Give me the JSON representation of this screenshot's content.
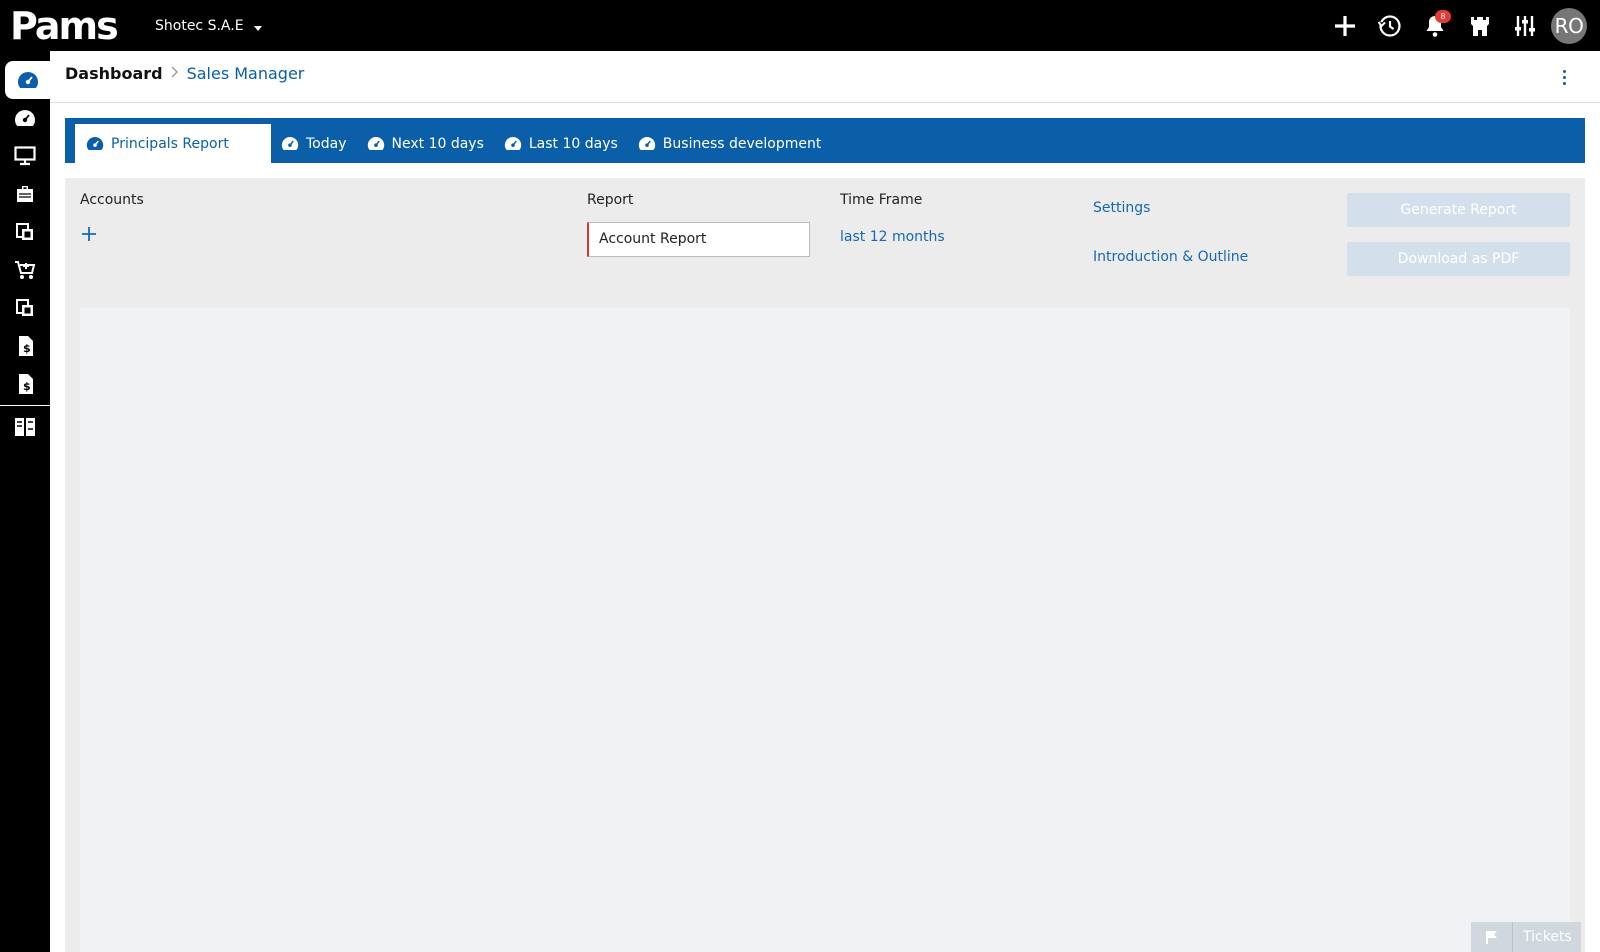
{
  "app": {
    "logo_text": "Pams",
    "company": "Shotec S.A.E",
    "notification_count": "8",
    "avatar_initials": "RO"
  },
  "top_icons": [
    "plus-icon",
    "history-icon",
    "bell-icon",
    "castle-icon",
    "sliders-icon"
  ],
  "sidebar": {
    "items": [
      "dashboard-icon",
      "gauge-icon",
      "monitor-icon",
      "briefcase-icon",
      "documents-icon",
      "cart-icon",
      "documents-icon",
      "invoice-icon",
      "invoice-icon",
      "reports-icon"
    ]
  },
  "breadcrumb": {
    "root": "Dashboard",
    "current": "Sales Manager"
  },
  "tabs": [
    {
      "label": "Principals Report",
      "active": true
    },
    {
      "label": "Today",
      "active": false
    },
    {
      "label": "Next 10 days",
      "active": false
    },
    {
      "label": "Last 10 days",
      "active": false
    },
    {
      "label": "Business development",
      "active": false
    }
  ],
  "form": {
    "accounts_label": "Accounts",
    "report_label": "Report",
    "report_value": "Account Report",
    "timeframe_label": "Time Frame",
    "timeframe_value": "last 12 months",
    "settings_link": "Settings",
    "intro_link": "Introduction & Outline",
    "generate_button": "Generate Report",
    "download_button": "Download as PDF"
  },
  "tickets": {
    "label": "Tickets"
  },
  "colors": {
    "accent": "#0b5ea8",
    "link": "#1568b8",
    "required": "#d9362b",
    "disabled_button": "#d3e0ec"
  }
}
